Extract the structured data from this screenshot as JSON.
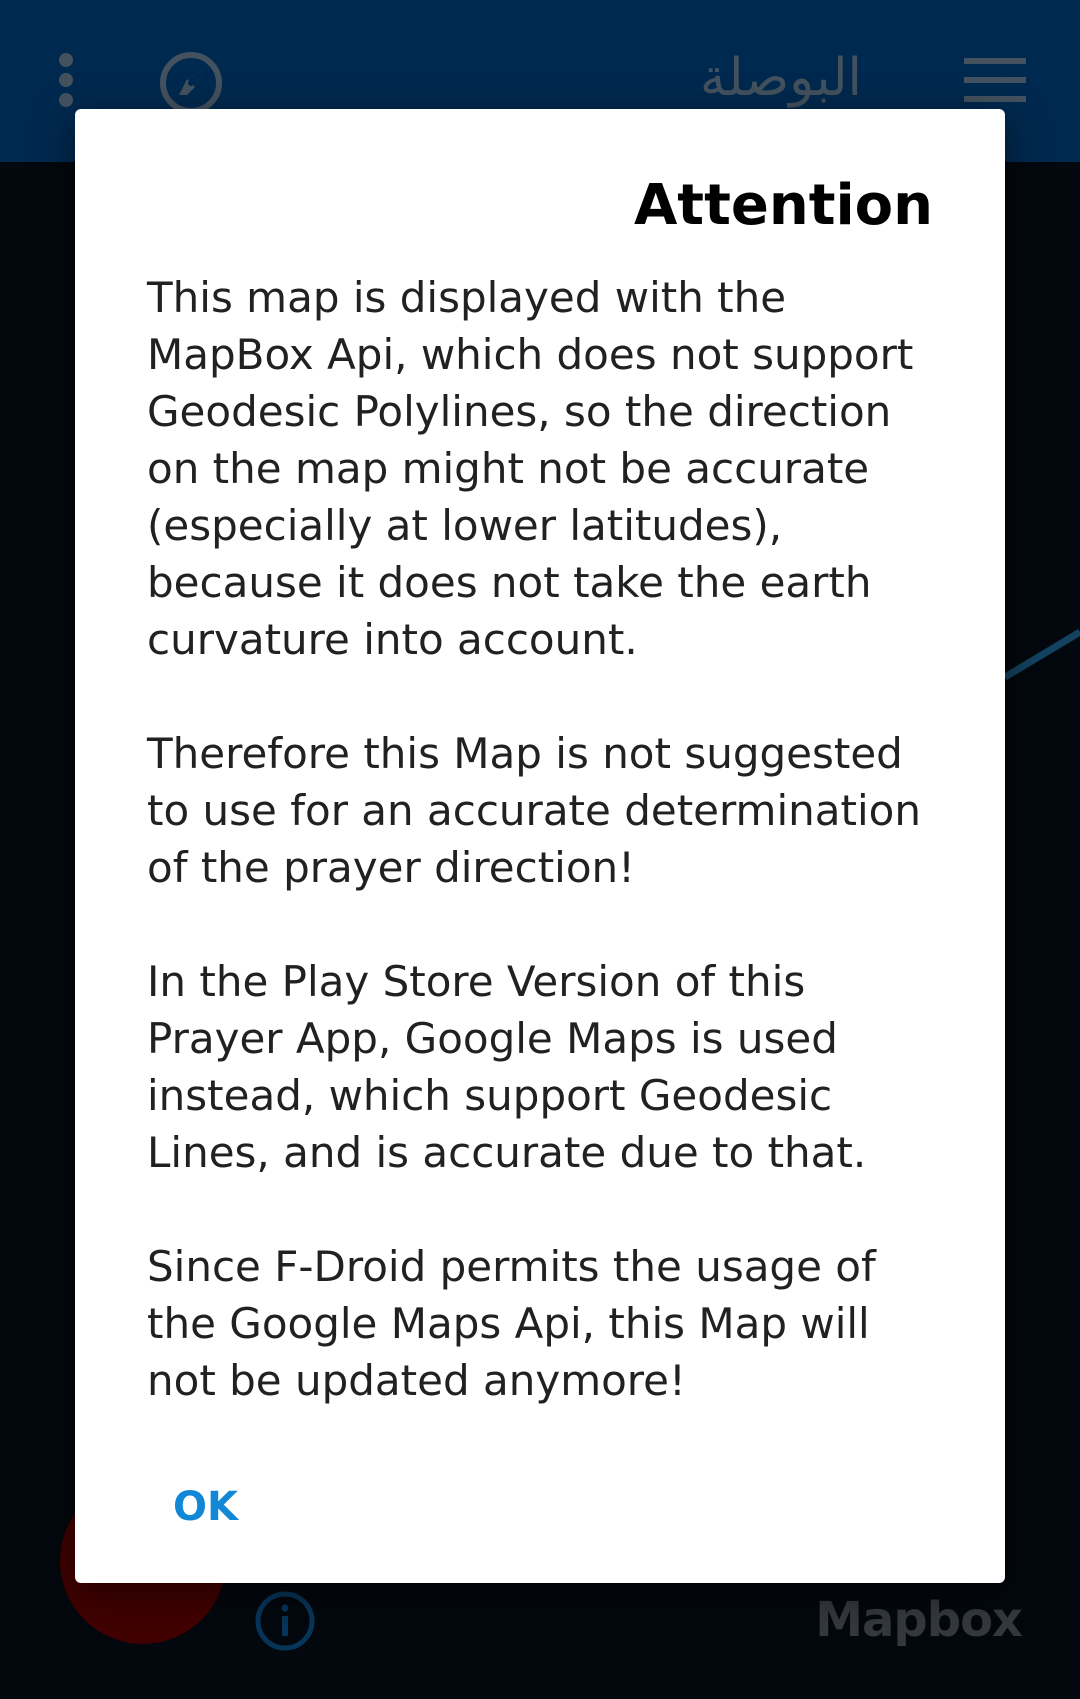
{
  "toolbar": {
    "title": "البوصلة",
    "overflow_icon": "more-vert-icon",
    "compass_icon": "compass-icon",
    "menu_icon": "hamburger-menu-icon",
    "background_color": "#003a6e"
  },
  "map": {
    "attribution_logo": "Mapbox",
    "info_icon": "info-icon",
    "fab_color": "#5a0000"
  },
  "dialog": {
    "title": "Attention",
    "paragraphs": [
      [
        "This map is displayed with the",
        "MapBox Api, which does not support",
        "Geodesic Polylines, so the direction",
        "on the map might not be accurate",
        "(especially at lower latitudes),",
        "because it does not take the earth",
        "curvature into account."
      ],
      [
        "Therefore this Map is not suggested",
        "to use for an accurate determination",
        "of the prayer direction!"
      ],
      [
        "In the Play Store Version of this",
        "Prayer App, Google Maps is used",
        "instead, which support Geodesic",
        "Lines, and is accurate due to that."
      ],
      [
        "Since F-Droid permits the usage of",
        "the Google Maps Api, this Map will",
        "not be updated anymore!"
      ]
    ],
    "ok_label": "OK",
    "accent_color": "#1287d6"
  }
}
